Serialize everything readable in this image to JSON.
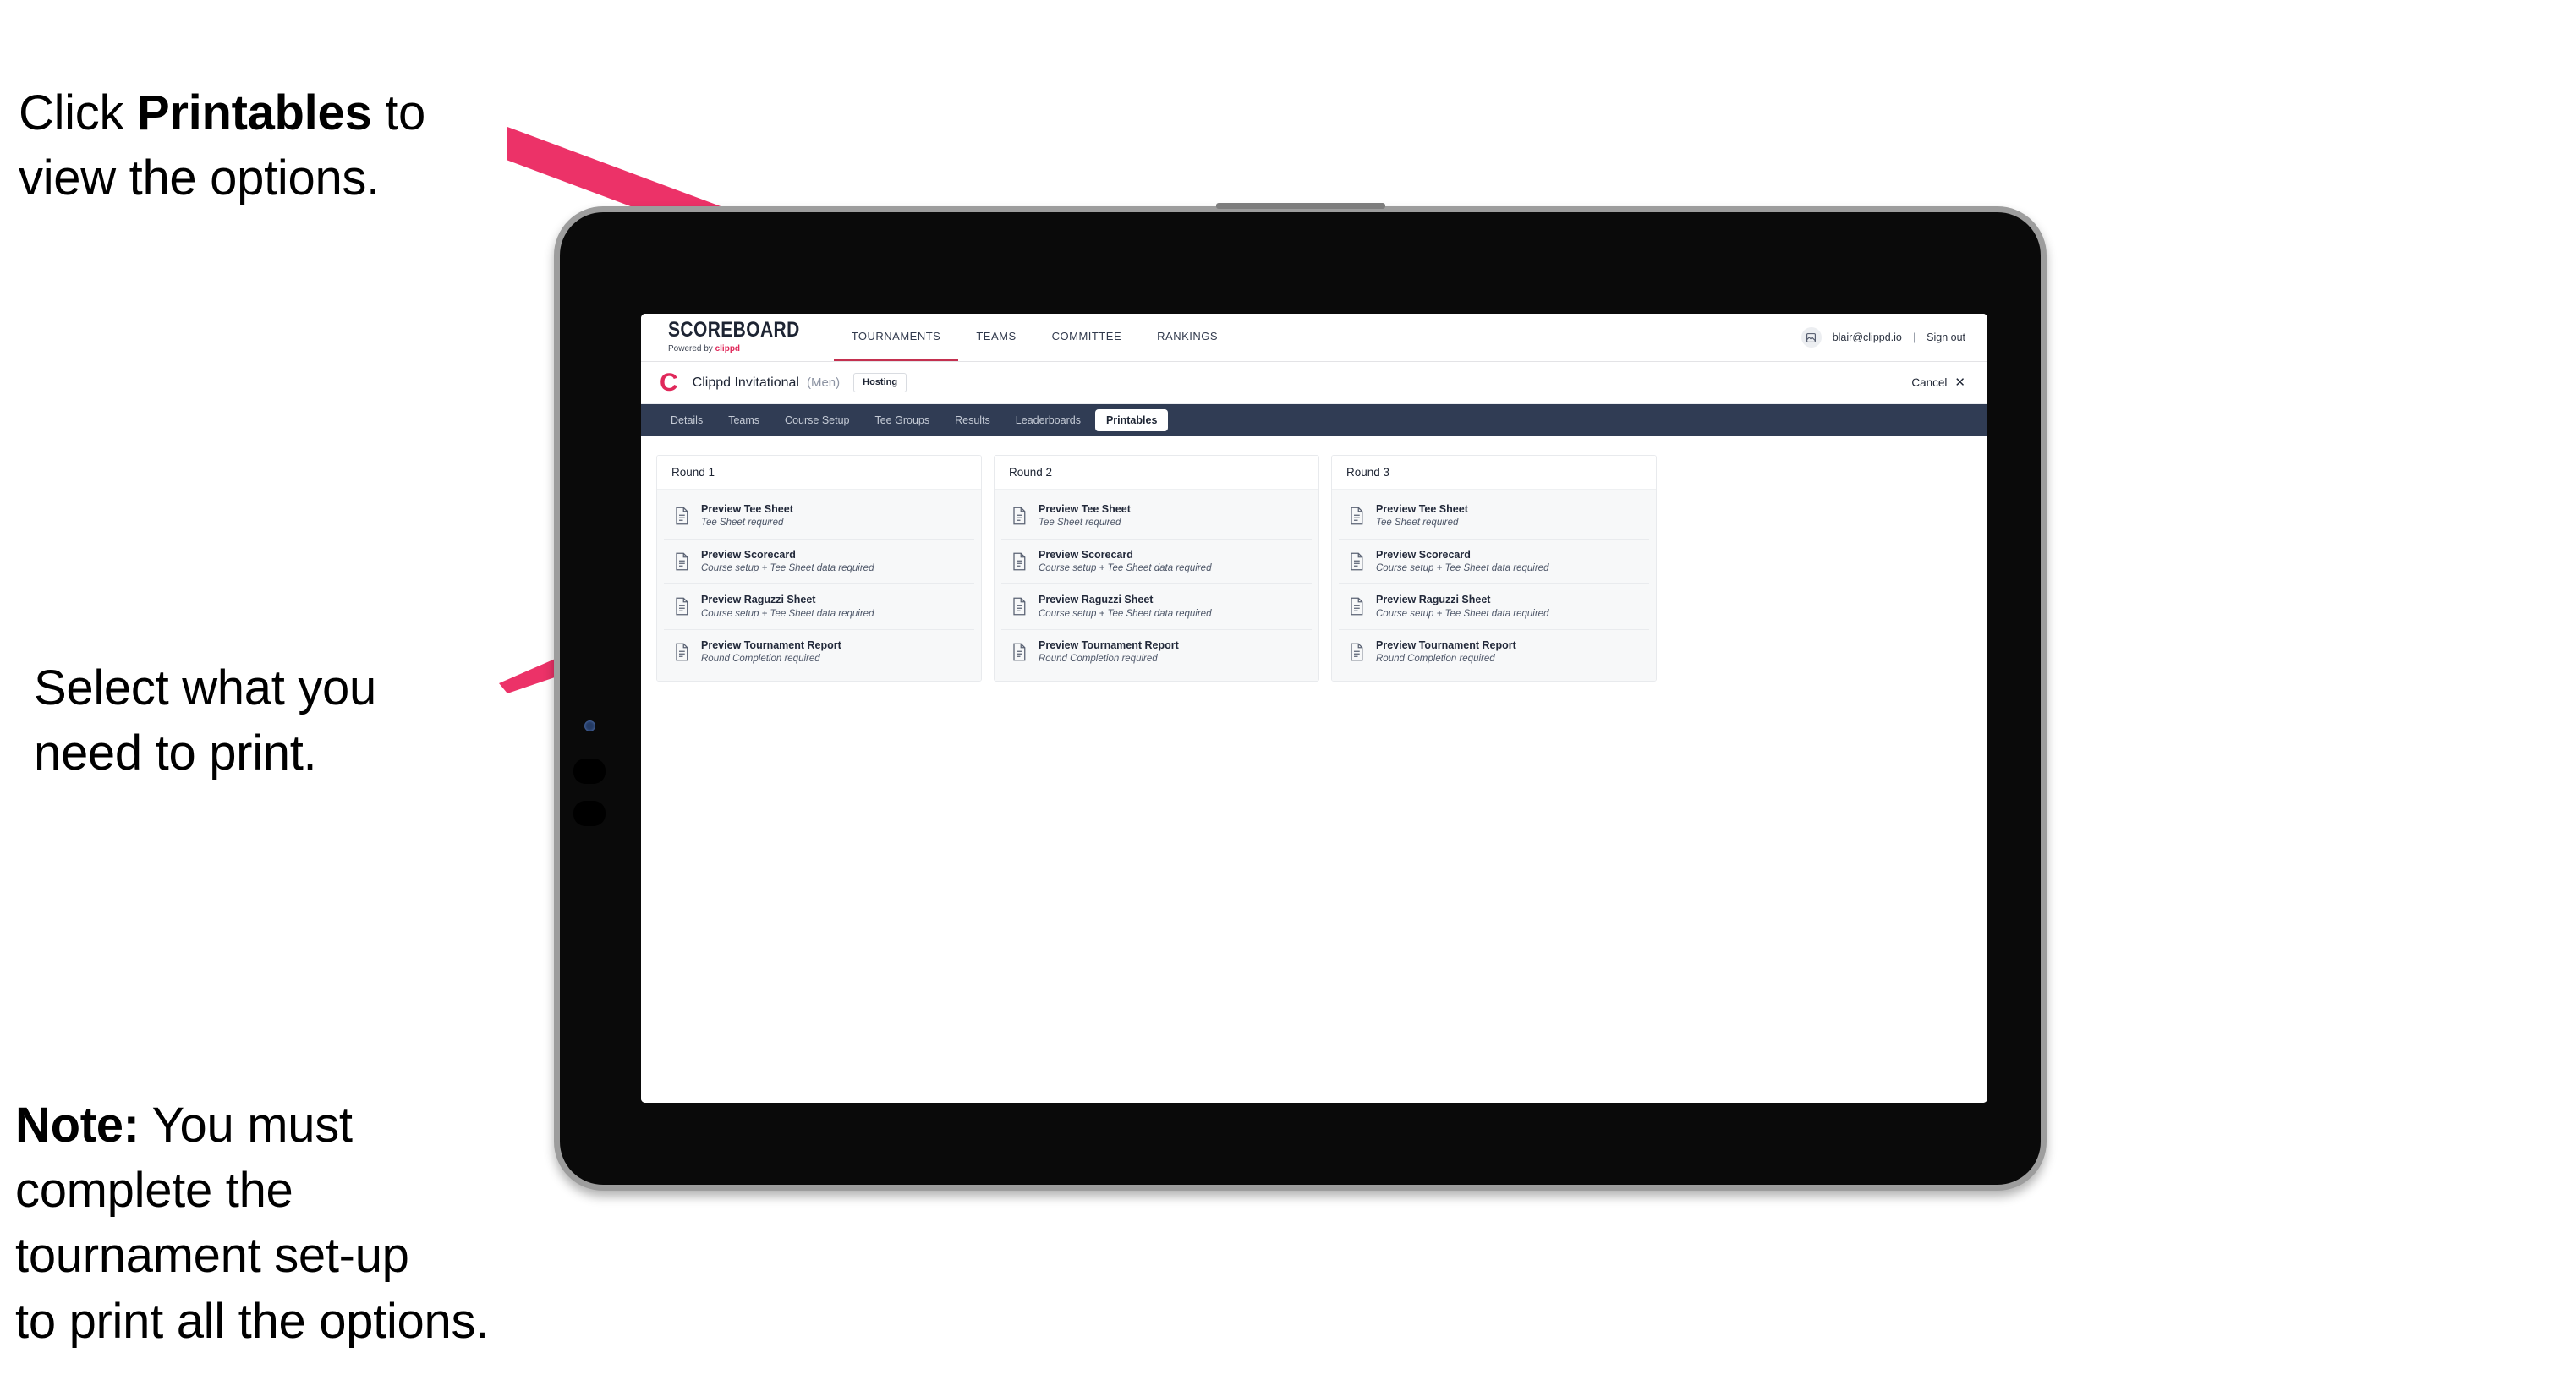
{
  "annotations": {
    "click_printables": {
      "prefix": "Click ",
      "bold": "Printables",
      "suffix": " to\nview the options."
    },
    "select_print": "Select what you\n need to print.",
    "note": {
      "bold": "Note:",
      "rest": " You must\ncomplete the\ntournament set-up\nto print all the options."
    }
  },
  "accent_colors": {
    "arrow_pink": "#ec3268",
    "brand_pink": "#e0285a",
    "tabstrip_navy": "#303c54",
    "active_underline": "#c4304f"
  },
  "app": {
    "brand": {
      "title": "SCOREBOARD",
      "powered_by": "Powered by ",
      "powered_by_mark": "clippd"
    },
    "topnav": [
      {
        "label": "TOURNAMENTS",
        "active": true
      },
      {
        "label": "TEAMS",
        "active": false
      },
      {
        "label": "COMMITTEE",
        "active": false
      },
      {
        "label": "RANKINGS",
        "active": false
      }
    ],
    "account": {
      "avatar_icon": "user-avatar-icon",
      "email": "blair@clippd.io",
      "separator": "|",
      "sign_out": "Sign out"
    },
    "tournament": {
      "logo_letter": "C",
      "name": "Clippd Invitational",
      "gender": "(Men)",
      "status_badge": "Hosting",
      "cancel_label": "Cancel",
      "cancel_icon": "close-icon"
    },
    "tabs": [
      {
        "label": "Details",
        "active": false
      },
      {
        "label": "Teams",
        "active": false
      },
      {
        "label": "Course Setup",
        "active": false
      },
      {
        "label": "Tee Groups",
        "active": false
      },
      {
        "label": "Results",
        "active": false
      },
      {
        "label": "Leaderboards",
        "active": false
      },
      {
        "label": "Printables",
        "active": true
      }
    ],
    "rounds": [
      {
        "title": "Round 1",
        "items": [
          {
            "title": "Preview Tee Sheet",
            "requirement": "Tee Sheet required"
          },
          {
            "title": "Preview Scorecard",
            "requirement": "Course setup + Tee Sheet data required"
          },
          {
            "title": "Preview Raguzzi Sheet",
            "requirement": "Course setup + Tee Sheet data required"
          },
          {
            "title": "Preview Tournament Report",
            "requirement": "Round Completion required"
          }
        ]
      },
      {
        "title": "Round 2",
        "items": [
          {
            "title": "Preview Tee Sheet",
            "requirement": "Tee Sheet required"
          },
          {
            "title": "Preview Scorecard",
            "requirement": "Course setup + Tee Sheet data required"
          },
          {
            "title": "Preview Raguzzi Sheet",
            "requirement": "Course setup + Tee Sheet data required"
          },
          {
            "title": "Preview Tournament Report",
            "requirement": "Round Completion required"
          }
        ]
      },
      {
        "title": "Round 3",
        "items": [
          {
            "title": "Preview Tee Sheet",
            "requirement": "Tee Sheet required"
          },
          {
            "title": "Preview Scorecard",
            "requirement": "Course setup + Tee Sheet data required"
          },
          {
            "title": "Preview Raguzzi Sheet",
            "requirement": "Course setup + Tee Sheet data required"
          },
          {
            "title": "Preview Tournament Report",
            "requirement": "Round Completion required"
          }
        ]
      }
    ]
  }
}
